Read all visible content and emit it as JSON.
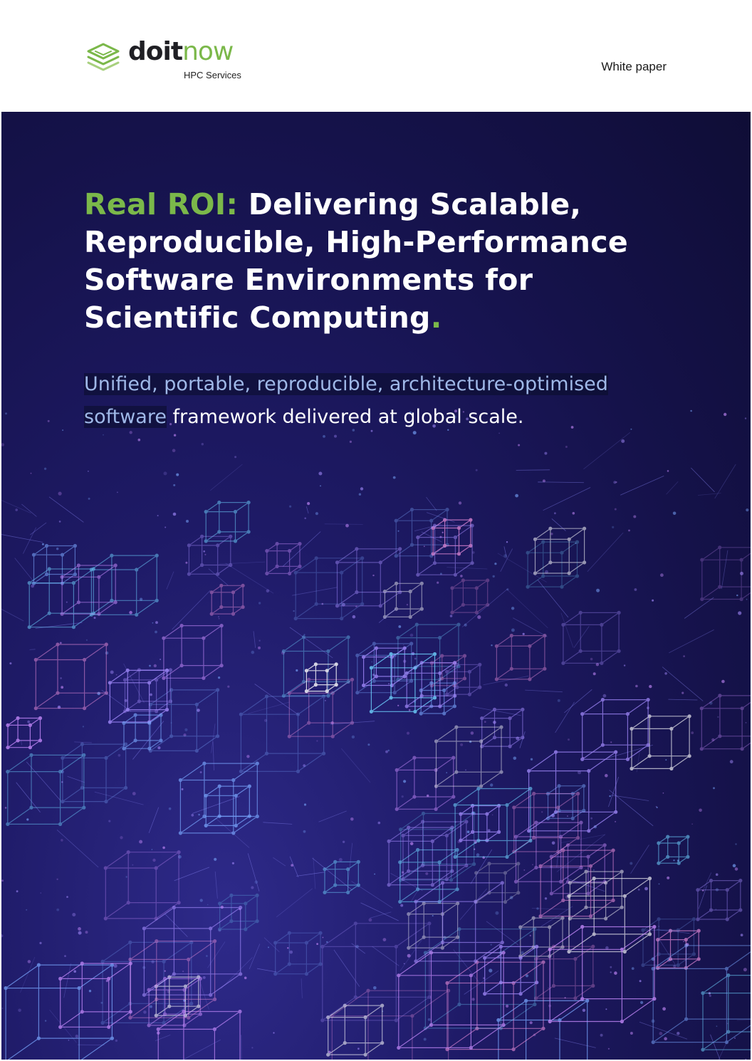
{
  "header": {
    "logo_word_a": "doit",
    "logo_word_b": "now",
    "logo_sub": "HPC Services",
    "doc_type": "White paper"
  },
  "cover": {
    "title_accent": "Real ROI:",
    "title_rest": " Delivering Scalable, Reproducible, High-Performance Software Environments for Scientific Computing",
    "title_dot": ".",
    "subtitle_highlight": "Unified, portable, reproducible, architecture-optimised software",
    "subtitle_rest": " framework delivered at global scale."
  },
  "colors": {
    "brand_green": "#7bb84a",
    "cover_navy": "#15124a",
    "highlight_blue": "#9fb8e8"
  }
}
